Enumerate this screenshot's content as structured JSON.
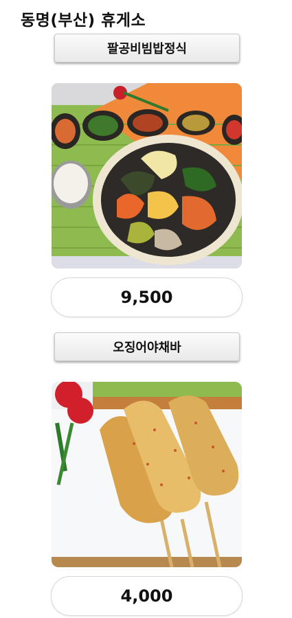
{
  "page": {
    "title": "동명(부산) 휴게소"
  },
  "menu": [
    {
      "name": "팔공비빔밥정식",
      "price": "9,500",
      "image": "bibimbap-photo"
    },
    {
      "name": "오징어야채바",
      "price": "4,000",
      "image": "fish-cake-bar-photo"
    }
  ]
}
